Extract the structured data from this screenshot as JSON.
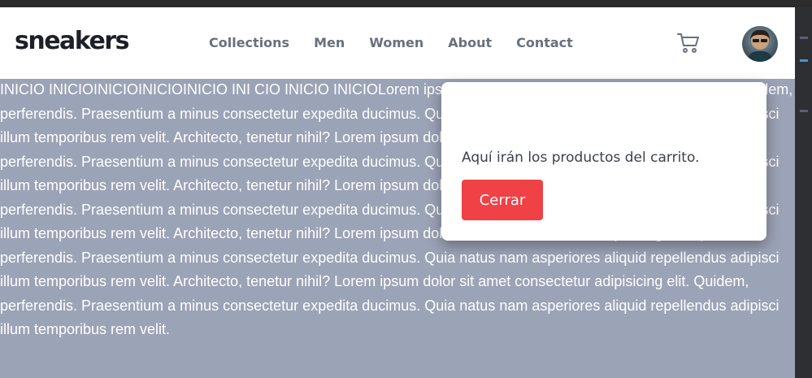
{
  "brand": {
    "logo": "sneakers"
  },
  "nav": {
    "items": [
      {
        "label": "Collections"
      },
      {
        "label": "Men"
      },
      {
        "label": "Women"
      },
      {
        "label": "About"
      },
      {
        "label": "Contact"
      }
    ]
  },
  "header": {
    "cart_icon": "cart-icon",
    "avatar_icon": "avatar"
  },
  "main": {
    "text": "INICIO INICIOINICIOINICIOINICIO INI CIO INICIO INICIOLorem ipsum dolor sit amet consectetur adipisicing elit. Quidem, perferendis. Praesentium a minus consectetur expedita ducimus. Quia natus nam asperiores aliquid repellendus adipisci illum temporibus rem velit. Architecto, tenetur nihil? Lorem ipsum dolor sit amet consectetur adipisicing elit. Quidem, perferendis. Praesentium a minus consectetur expedita ducimus. Quia natus nam asperiores aliquid repellendus adipisci illum temporibus rem velit. Architecto, tenetur nihil? Lorem ipsum dolor sit amet consectetur adipisicing elit. Quidem, perferendis. Praesentium a minus consectetur expedita ducimus. Quia natus nam asperiores aliquid repellendus adipisci illum temporibus rem velit. Architecto, tenetur nihil? Lorem ipsum dolor sit amet consectetur adipisicing elit. Quidem, perferendis. Praesentium a minus consectetur expedita ducimus. Quia natus nam asperiores aliquid repellendus adipisci illum temporibus rem velit. Architecto, tenetur nihil? Lorem ipsum dolor sit amet consectetur adipisicing elit. Quidem, perferendis. Praesentium a minus consectetur expedita ducimus. Quia natus nam asperiores aliquid repellendus adipisci illum temporibus rem velit."
  },
  "modal": {
    "text": "Aquí irán los productos del carrito.",
    "close_label": "Cerrar"
  },
  "colors": {
    "overlay_bg": "#9ba3b6",
    "close_button": "#ef4146",
    "logo": "#1d2026",
    "nav_text": "#69707d"
  }
}
